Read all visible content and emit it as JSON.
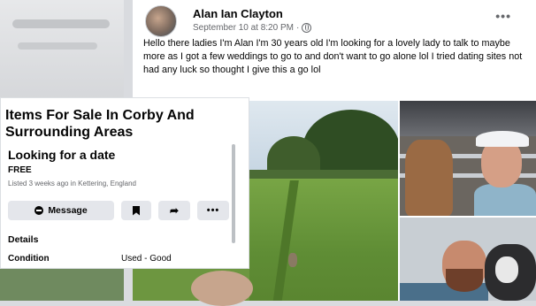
{
  "post": {
    "author": "Alan Ian Clayton",
    "timestamp": "September 10 at 8:20 PM",
    "separator": "·",
    "privacy_icon": "globe-icon",
    "more_icon": "more-dots-icon",
    "more_glyph": "•••",
    "text": "Hello there ladies I'm Alan I'm 30 years old  I'm looking for a lovely lady to talk to maybe more as I got a few weddings to go to and don't want to go alone lol I tried dating sites not had any luck so thought I give this a go lol"
  },
  "listing": {
    "group_title": "Items For Sale In Corby And Surrounding Areas",
    "title": "Looking for a date",
    "price": "FREE",
    "listed": "Listed 3 weeks ago in Kettering, England",
    "buttons": {
      "message": "Message",
      "save_icon": "bookmark-icon",
      "share_icon": "share-icon",
      "share_glyph": "➦",
      "more_icon": "more-dots-icon",
      "more_glyph": "•••"
    },
    "details_label": "Details",
    "condition_label": "Condition",
    "condition_value": "Used - Good"
  },
  "colors": {
    "text_primary": "#050505",
    "text_secondary": "#65676b",
    "button_bg": "#e4e6eb",
    "card_bg": "#ffffff"
  }
}
